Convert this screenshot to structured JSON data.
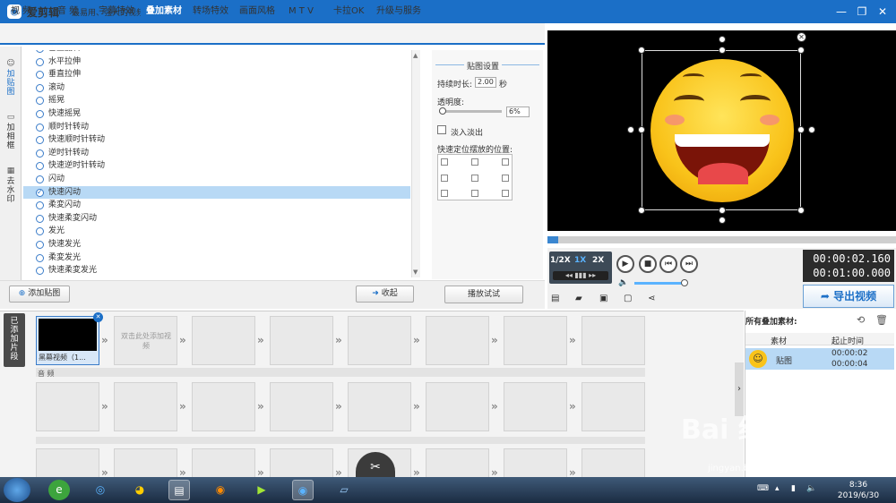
{
  "window": {
    "title": "爱剪辑",
    "slogan": "最易用、强大的视频剪辑软件",
    "controls": [
      "minimize-icon",
      "restore-icon",
      "close-icon"
    ]
  },
  "tabs": [
    "视 频",
    "音 频",
    "字幕特效",
    "叠加素材",
    "转场特效",
    "画面风格",
    "M T V",
    "卡拉OK",
    "升级与服务"
  ],
  "active_tab": "叠加素材",
  "side_tabs": [
    "加贴图",
    "加相框",
    "去水印"
  ],
  "effects": {
    "cut_top": "垂直翻转",
    "items": [
      "水平拉伸",
      "垂直拉伸",
      "滚动",
      "摇晃",
      "快速摇晃",
      "顺时针转动",
      "快速顺时针转动",
      "逆时针转动",
      "快速逆时针转动",
      "闪动",
      "快速闪动",
      "柔変闪动",
      "快速柔変闪动",
      "发光",
      "快速发光",
      "柔変发光",
      "快速柔変发光"
    ],
    "selected": "快速闪动"
  },
  "settings": {
    "header": "贴图设置",
    "duration_label": "持续时长:",
    "duration_value": "2.00",
    "duration_unit": "秒",
    "opacity_label": "透明度:",
    "opacity_value": "6%",
    "fade_label": "淡入淡出",
    "position_label": "快速定位摆放的位置:",
    "preview_button": "播放试试"
  },
  "buttons": {
    "add_sticker": "添加贴图",
    "collapse": "收起"
  },
  "player": {
    "speeds": [
      "1/2X",
      "1X",
      "2X"
    ],
    "current_time": "00:00:02.160",
    "total_time": "00:01:00.000",
    "export": "导出视频",
    "progress": 0.03
  },
  "timeline": {
    "side_label": "已添加片段",
    "first_clip": "黑幕视频（1...",
    "add_hint": "双击此处添加视频",
    "audio_label": "音 频"
  },
  "materials": {
    "header": "所有叠加素材:",
    "col_material": "素材",
    "col_time": "起止时间",
    "row_name": "贴图",
    "row_start": "00:00:02",
    "row_end": "00:00:04"
  },
  "taskbar": {
    "time": "8:36",
    "date": "2019/6/30"
  },
  "watermark": {
    "text": "Bai 经验",
    "sub": "jingyan.baidu.com"
  }
}
